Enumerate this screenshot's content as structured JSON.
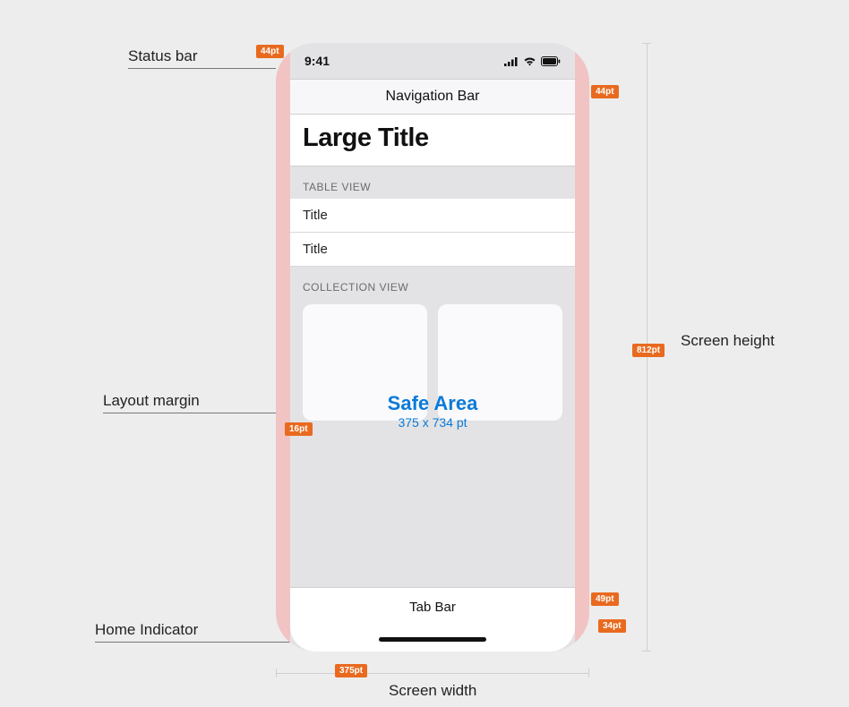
{
  "callouts": {
    "status_bar": "Status bar",
    "layout_margin": "Layout margin",
    "home_indicator": "Home Indicator",
    "screen_height": "Screen height",
    "screen_width": "Screen width"
  },
  "status": {
    "time": "9:41"
  },
  "nav": {
    "title": "Navigation Bar"
  },
  "large_title": "Large Title",
  "sections": {
    "table": {
      "header": "TABLE VIEW",
      "rows": [
        "Title",
        "Title"
      ]
    },
    "collection": {
      "header": "COLLECTION VIEW"
    }
  },
  "safe_area": {
    "title": "Safe Area",
    "dims": "375 x 734 pt"
  },
  "tab_bar": {
    "label": "Tab Bar"
  },
  "badges": {
    "status_bar_height": "44pt",
    "nav_bar_height": "44pt",
    "layout_margin_width": "16pt",
    "screen_height_value": "812pt",
    "tab_bar_height": "49pt",
    "home_indicator_height": "34pt",
    "screen_width_value": "375pt"
  }
}
